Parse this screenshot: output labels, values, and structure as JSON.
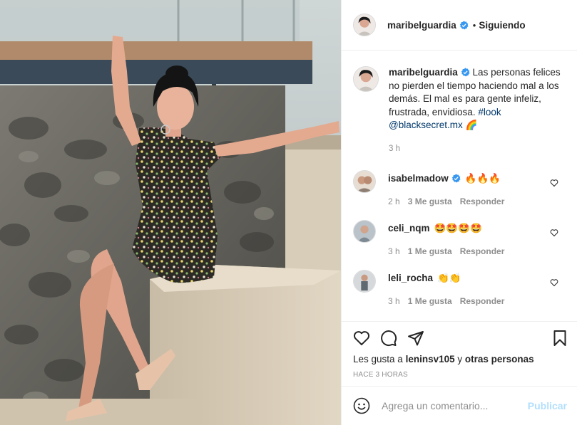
{
  "post": {
    "author": "maribelguardia",
    "follow_status": "Siguiendo",
    "separator": "•",
    "caption_text": "Las personas felices no pierden el tiempo haciendo mal a los demás. El mal es para gente infeliz, frustrada, envidiosa.",
    "caption_hashtag": "#look",
    "caption_mention": "@blacksecret.mx",
    "caption_emoji": "🌈",
    "caption_time": "3 h"
  },
  "comments": [
    {
      "user": "isabelmadow",
      "verified": true,
      "text": "🔥🔥🔥",
      "time": "2 h",
      "likes": "3 Me gusta",
      "reply": "Responder"
    },
    {
      "user": "celi_nqm",
      "verified": false,
      "text": "🤩🤩🤩🤩",
      "time": "3 h",
      "likes": "1 Me gusta",
      "reply": "Responder"
    },
    {
      "user": "leli_rocha",
      "verified": false,
      "text": "👏👏",
      "time": "3 h",
      "likes": "1 Me gusta",
      "reply": "Responder"
    }
  ],
  "likes_line": {
    "prefix": "Les gusta a",
    "user": "leninsv105",
    "joiner": "y",
    "others": "otras personas"
  },
  "posted_ago": "HACE 3 HORAS",
  "add_comment": {
    "placeholder": "Agrega un comentario...",
    "publish_label": "Publicar"
  },
  "icons": {
    "verified": "verified-badge-icon",
    "like": "heart-icon",
    "comment": "comment-bubble-icon",
    "share": "paper-plane-icon",
    "save": "bookmark-icon",
    "emoji": "smiley-icon"
  },
  "colors": {
    "verified_blue": "#3897f0",
    "link": "#00376b",
    "muted": "#8e8e8e",
    "publish_disabled": "#b2dffc"
  }
}
